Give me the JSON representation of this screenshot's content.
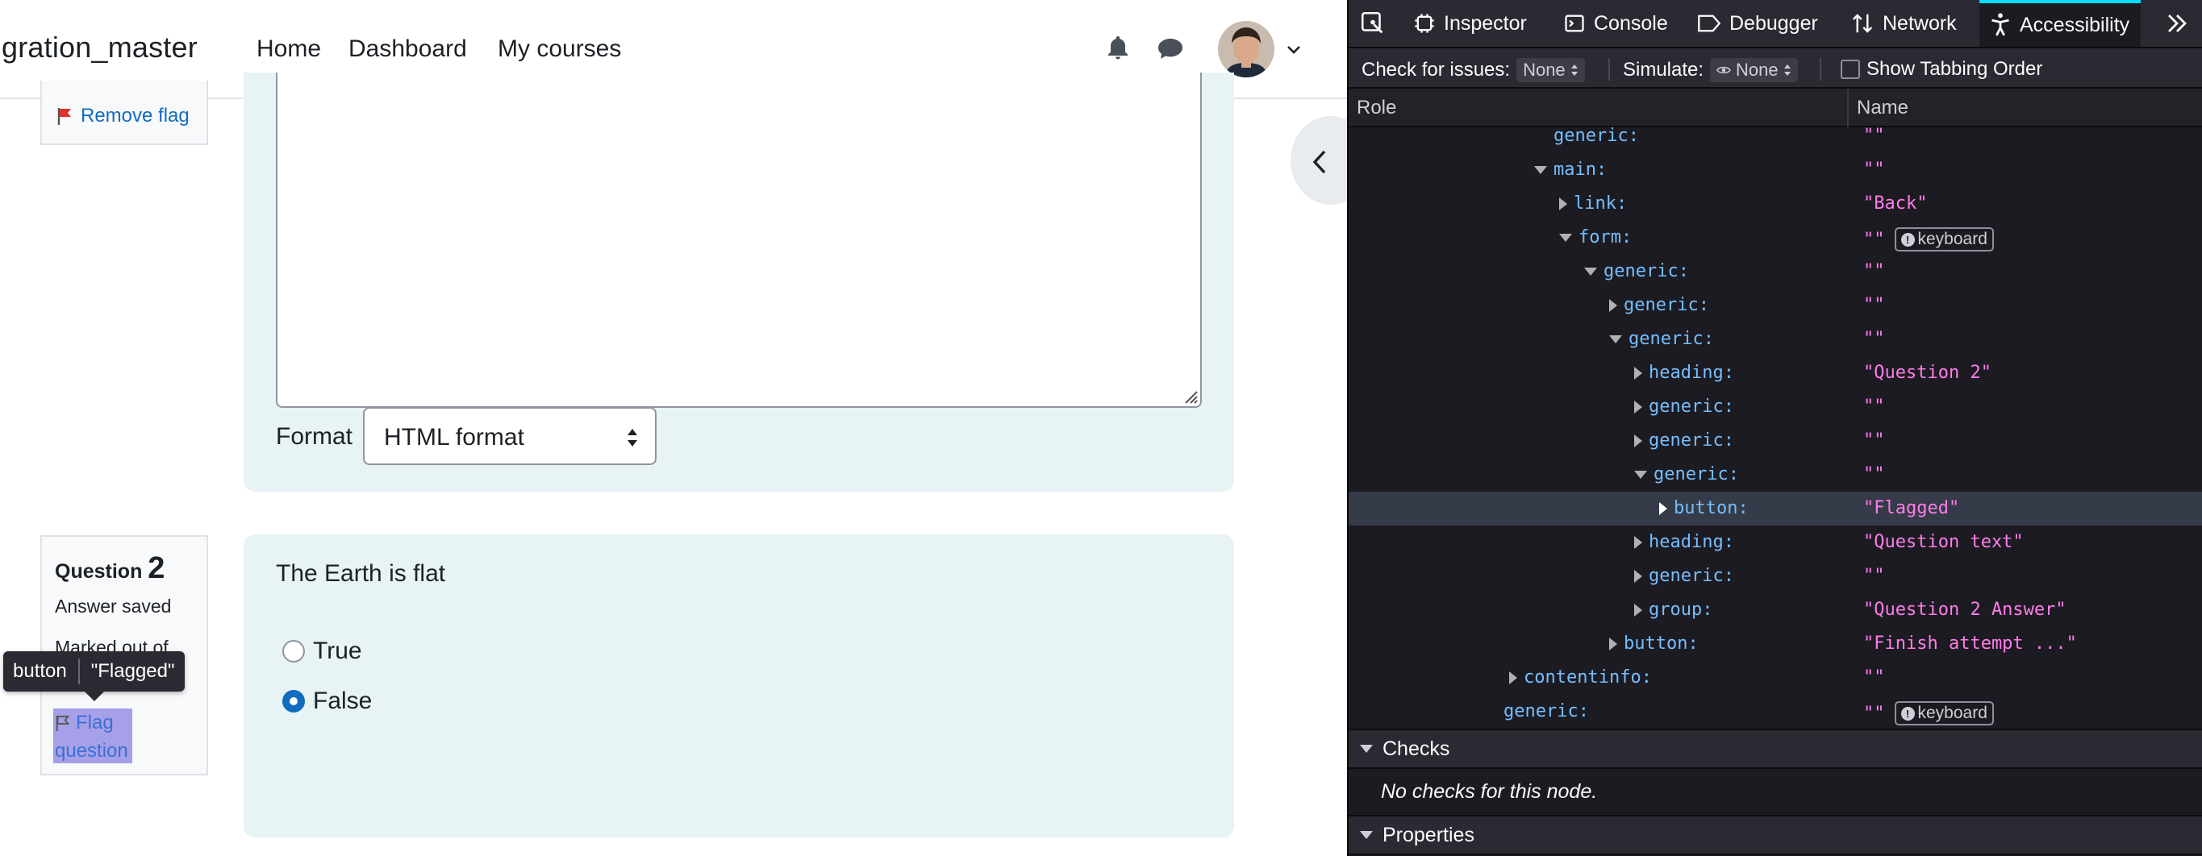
{
  "page": {
    "brand": "gration_master",
    "nav": {
      "home": "Home",
      "dashboard": "Dashboard",
      "my_courses": "My courses"
    },
    "remove_flag": "Remove flag",
    "format_label": "Format",
    "format_value": "HTML format",
    "question": {
      "label": "Question",
      "number": "2",
      "state": "Answer saved",
      "marked": "Marked out of",
      "flag_line1": "Flag",
      "flag_line2": "question",
      "text": "The Earth is flat",
      "options": [
        "True",
        "False"
      ],
      "selected": "False"
    },
    "tooltip": {
      "role": "button",
      "name": "\"Flagged\""
    }
  },
  "devtools": {
    "tabs": {
      "inspector": "Inspector",
      "console": "Console",
      "debugger": "Debugger",
      "network": "Network",
      "accessibility": "Accessibility"
    },
    "toolbar": {
      "check_label": "Check for issues:",
      "check_value": "None",
      "simulate_label": "Simulate:",
      "simulate_value": "None",
      "tabbing": "Show Tabbing Order"
    },
    "columns": {
      "role": "Role",
      "name": "Name"
    },
    "tree": [
      {
        "role": "generic:",
        "name": "\"\"",
        "depth": 0,
        "twisty": "none"
      },
      {
        "role": "main:",
        "name": "\"\"",
        "depth": 0,
        "twisty": "down"
      },
      {
        "role": "link:",
        "name": "\"Back\"",
        "depth": 1,
        "twisty": "right"
      },
      {
        "role": "form:",
        "name": "\"\"",
        "depth": 1,
        "twisty": "down",
        "badge": "keyboard"
      },
      {
        "role": "generic:",
        "name": "\"\"",
        "depth": 2,
        "twisty": "down"
      },
      {
        "role": "generic:",
        "name": "\"\"",
        "depth": 3,
        "twisty": "right"
      },
      {
        "role": "generic:",
        "name": "\"\"",
        "depth": 3,
        "twisty": "down"
      },
      {
        "role": "heading:",
        "name": "\"Question 2\"",
        "depth": 4,
        "twisty": "right"
      },
      {
        "role": "generic:",
        "name": "\"\"",
        "depth": 4,
        "twisty": "right"
      },
      {
        "role": "generic:",
        "name": "\"\"",
        "depth": 4,
        "twisty": "right"
      },
      {
        "role": "generic:",
        "name": "\"\"",
        "depth": 4,
        "twisty": "down"
      },
      {
        "role": "button:",
        "name": "\"Flagged\"",
        "depth": 5,
        "twisty": "right",
        "selected": true
      },
      {
        "role": "heading:",
        "name": "\"Question text\"",
        "depth": 4,
        "twisty": "right"
      },
      {
        "role": "generic:",
        "name": "\"\"",
        "depth": 4,
        "twisty": "right"
      },
      {
        "role": "group:",
        "name": "\"Question 2 Answer\"",
        "depth": 4,
        "twisty": "right"
      },
      {
        "role": "button:",
        "name": "\"Finish attempt ...\"",
        "depth": 3,
        "twisty": "right"
      },
      {
        "role": "contentinfo:",
        "name": "\"\"",
        "depth": -1,
        "twisty": "right"
      },
      {
        "role": "generic:",
        "name": "\"\"",
        "depth": -2,
        "twisty": "none",
        "badge": "keyboard"
      }
    ],
    "sections": {
      "checks": "Checks",
      "no_checks": "No checks for this node.",
      "properties": "Properties"
    }
  }
}
